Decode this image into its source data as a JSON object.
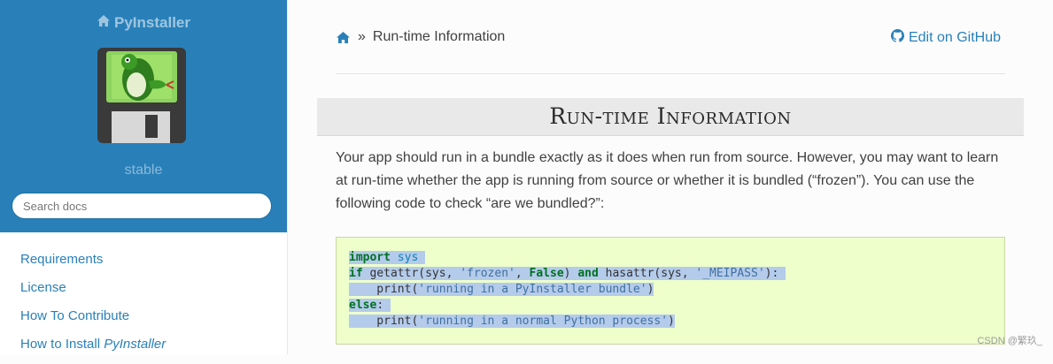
{
  "sidebar": {
    "brand": "PyInstaller",
    "version": "stable",
    "search_placeholder": "Search docs",
    "nav": [
      {
        "label": "Requirements"
      },
      {
        "label": "License"
      },
      {
        "label": "How To Contribute"
      },
      {
        "label_prefix": "How to Install ",
        "label_em": "PyInstaller"
      }
    ]
  },
  "breadcrumb": {
    "separator": "»",
    "current": "Run-time Information",
    "edit_link": "Edit on GitHub"
  },
  "page": {
    "title": "Run-time Information",
    "paragraph": "Your app should run in a bundle exactly as it does when run from source. However, you may want to learn at run-time whether the app is running from source or whether it is bundled (“frozen”). You can use the following code to check “are we bundled?”:"
  },
  "code": {
    "l1_kw": "import",
    "l1_mod": " sys",
    "l2_if": "if",
    "l2_a": " getattr(sys, ",
    "l2_s1": "'frozen'",
    "l2_b": ", ",
    "l2_false": "False",
    "l2_c": ") ",
    "l2_and": "and",
    "l2_d": " hasattr(sys, ",
    "l2_s2": "'_MEIPASS'",
    "l2_e": "):",
    "l3_indent": "    print(",
    "l3_s": "'running in a PyInstaller bundle'",
    "l3_end": ")",
    "l4_else": "else",
    "l4_colon": ":",
    "l5_indent": "    print(",
    "l5_s": "'running in a normal Python process'",
    "l5_end": ")"
  },
  "watermark": "CSDN @繁玖_",
  "colors": {
    "sidebar_bg": "#2980b9",
    "link": "#2980b9",
    "code_bg": "#eeffcc",
    "selection": "#b4cbeb"
  },
  "icons": [
    "home-icon",
    "github-icon",
    "pyinstaller-logo"
  ]
}
